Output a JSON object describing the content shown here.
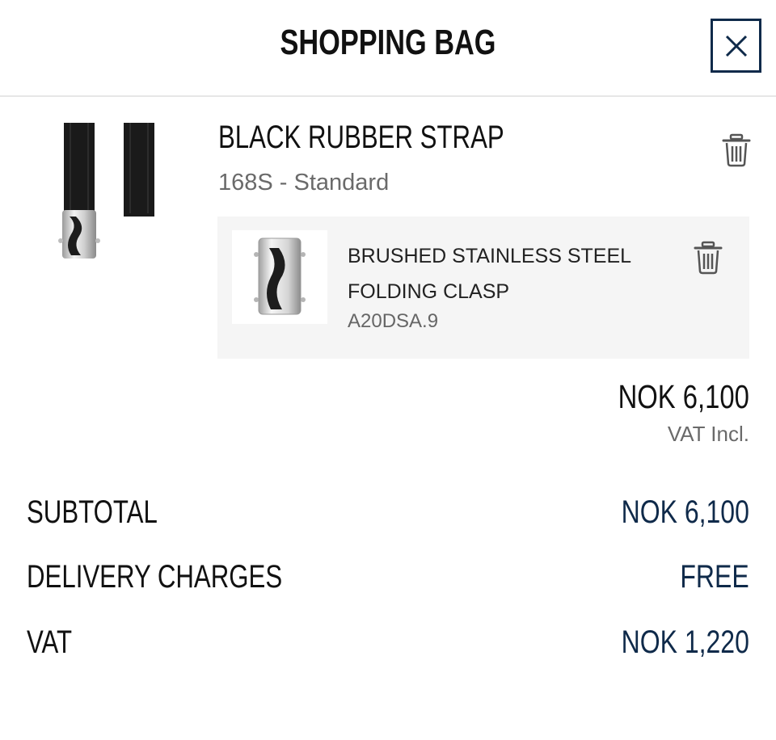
{
  "header": {
    "title": "SHOPPING BAG",
    "close_icon": "close-icon"
  },
  "item": {
    "title": "BLACK RUBBER STRAP",
    "variant": "168S - Standard",
    "image_icon": "strap-image",
    "remove_icon": "trash-icon"
  },
  "accessory": {
    "title_line1": "BRUSHED STAINLESS STEEL",
    "title_line2": "FOLDING CLASP",
    "code": "A20DSA.9",
    "image_icon": "clasp-image",
    "remove_icon": "trash-icon"
  },
  "price": {
    "amount": "NOK 6,100",
    "note": "VAT Incl."
  },
  "summary": {
    "rows": [
      {
        "label": "SUBTOTAL",
        "value": "NOK 6,100"
      },
      {
        "label": "DELIVERY CHARGES",
        "value": "FREE"
      },
      {
        "label": "VAT",
        "value": "NOK 1,220"
      }
    ]
  },
  "colors": {
    "accent": "#0f2a4a",
    "muted": "#6a6a6a",
    "panel": "#f5f5f5"
  }
}
